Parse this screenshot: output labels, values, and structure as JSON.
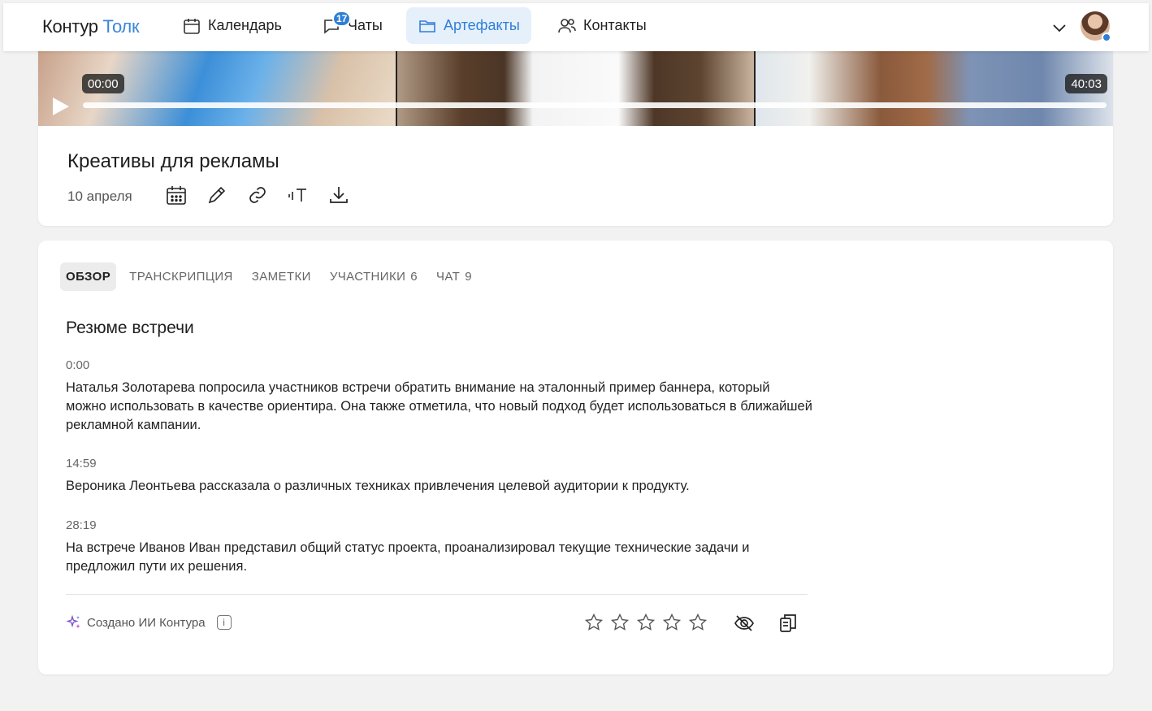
{
  "header": {
    "logo_brand": "Контур",
    "logo_product": "Толк",
    "nav": [
      {
        "label": "Календарь",
        "icon": "calendar-icon"
      },
      {
        "label": "Чаты",
        "icon": "chat-icon",
        "badge": "17"
      },
      {
        "label": "Артефакты",
        "icon": "folder-icon",
        "active": true
      },
      {
        "label": "Контакты",
        "icon": "contacts-icon"
      }
    ],
    "accent_color": "#2f7fd6"
  },
  "video": {
    "current_time": "00:00",
    "duration": "40:03",
    "progress_fraction": 0
  },
  "meeting": {
    "title": "Креативы для рекламы",
    "date": "10 апреля",
    "tools": [
      "calendar-icon",
      "pencil-icon",
      "link-icon",
      "text-size-icon",
      "download-icon"
    ]
  },
  "tabs": [
    {
      "label": "ОБЗОР",
      "count": "",
      "active": true
    },
    {
      "label": "ТРАНСКРИПЦИЯ",
      "count": ""
    },
    {
      "label": "ЗАМЕТКИ",
      "count": ""
    },
    {
      "label": "УЧАСТНИКИ",
      "count": "6"
    },
    {
      "label": "ЧАТ",
      "count": "9"
    }
  ],
  "summary": {
    "title": "Резюме встречи",
    "entries": [
      {
        "time": "0:00",
        "text": "Наталья Золотарева попросила участников встречи обратить внимание на эталонный пример баннера, который можно использовать в качестве ориентира. Она также отметила, что новый подход будет использоваться в ближайшей рекламной кампании."
      },
      {
        "time": "14:59",
        "text": "Вероника Леонтьева рассказала о различных техниках привлечения целевой аудитории к продукту."
      },
      {
        "time": "28:19",
        "text": "На встрече Иванов Иван представил общий статус проекта, проанализировал текущие технические задачи и предложил пути их решения."
      }
    ]
  },
  "footer": {
    "ai_label": "Создано ИИ Контура",
    "info_glyph": "i",
    "rating": 0,
    "max_rating": 5
  }
}
